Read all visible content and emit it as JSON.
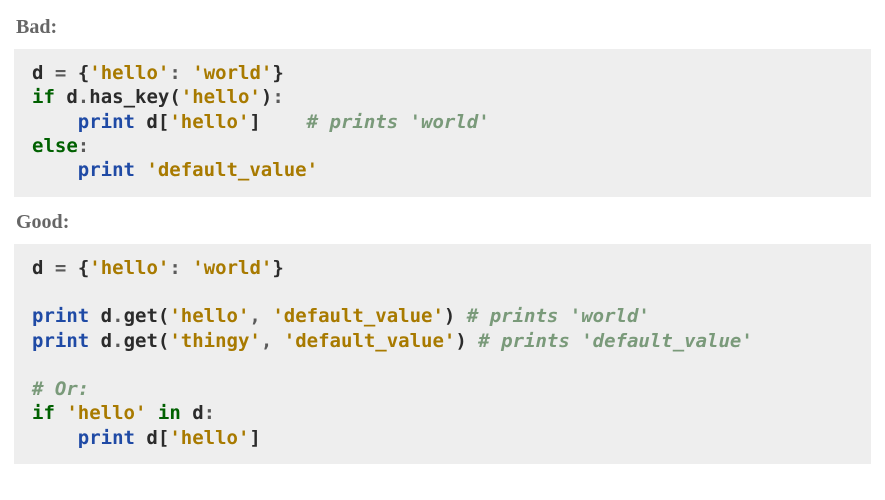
{
  "labels": {
    "bad": "Bad",
    "good": "Good"
  },
  "bad": {
    "line1": {
      "var": "d",
      "op": "=",
      "brace_open": "{",
      "key": "'hello'",
      "colon": ":",
      "val": "'world'",
      "brace_close": "}"
    },
    "line2": {
      "kw_if": "if",
      "var": "d",
      "dot": ".",
      "method": "has_key",
      "lpar": "(",
      "arg": "'hello'",
      "rpar": ")",
      "colon": ":"
    },
    "line3": {
      "print": "print",
      "var": "d",
      "lbr": "[",
      "key": "'hello'",
      "rbr": "]",
      "comment": "# prints 'world'"
    },
    "line4": {
      "kw_else": "else",
      "colon": ":"
    },
    "line5": {
      "print": "print",
      "val": "'default_value'"
    }
  },
  "good": {
    "line1": {
      "var": "d",
      "op": "=",
      "brace_open": "{",
      "key": "'hello'",
      "colon": ":",
      "val": "'world'",
      "brace_close": "}"
    },
    "line3": {
      "print": "print",
      "var": "d",
      "dot": ".",
      "method": "get",
      "lpar": "(",
      "arg1": "'hello'",
      "comma": ",",
      "arg2": "'default_value'",
      "rpar": ")",
      "comment": "# prints 'world'"
    },
    "line4": {
      "print": "print",
      "var": "d",
      "dot": ".",
      "method": "get",
      "lpar": "(",
      "arg1": "'thingy'",
      "comma": ",",
      "arg2": "'default_value'",
      "rpar": ")",
      "comment": "# prints 'default_value'"
    },
    "line6": {
      "comment": "# Or:"
    },
    "line7": {
      "kw_if": "if",
      "key": "'hello'",
      "kw_in": "in",
      "var": "d",
      "colon": ":"
    },
    "line8": {
      "print": "print",
      "var": "d",
      "lbr": "[",
      "key": "'hello'",
      "rbr": "]"
    }
  }
}
